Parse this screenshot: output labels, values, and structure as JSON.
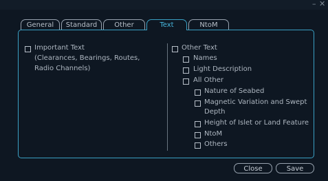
{
  "window": {
    "minimize_glyph": "–",
    "close_glyph": "✕"
  },
  "tabs": [
    {
      "label": "General",
      "active": false
    },
    {
      "label": "Standard",
      "active": false
    },
    {
      "label": "Other",
      "active": false
    },
    {
      "label": "Text",
      "active": true
    },
    {
      "label": "NtoM",
      "active": false
    }
  ],
  "left": {
    "important_text": {
      "label": "Important Text",
      "checked": false
    },
    "important_text_detail": [
      "(Clearances, Bearings, Routes,",
      "Radio Channels)"
    ]
  },
  "right": {
    "other_text": {
      "label": "Other Text",
      "checked": false
    },
    "names": {
      "label": "Names",
      "checked": false
    },
    "light_description": {
      "label": "Light Description",
      "checked": false
    },
    "all_other": {
      "label": "All Other",
      "checked": false
    },
    "nature_of_seabed": {
      "label": "Nature of Seabed",
      "checked": false
    },
    "magnetic_variation": {
      "label": "Magnetic Variation and Swept",
      "label_cont": "Depth",
      "checked": false
    },
    "height_of_islet": {
      "label": "Height of Islet or Land Feature",
      "checked": false
    },
    "ntom": {
      "label": "NtoM",
      "checked": false
    },
    "others": {
      "label": "Others",
      "checked": false
    }
  },
  "buttons": {
    "close": "Close",
    "save": "Save"
  },
  "colors": {
    "accent": "#3aa0c4",
    "background": "#0e1722",
    "text": "#aeb7c1"
  }
}
